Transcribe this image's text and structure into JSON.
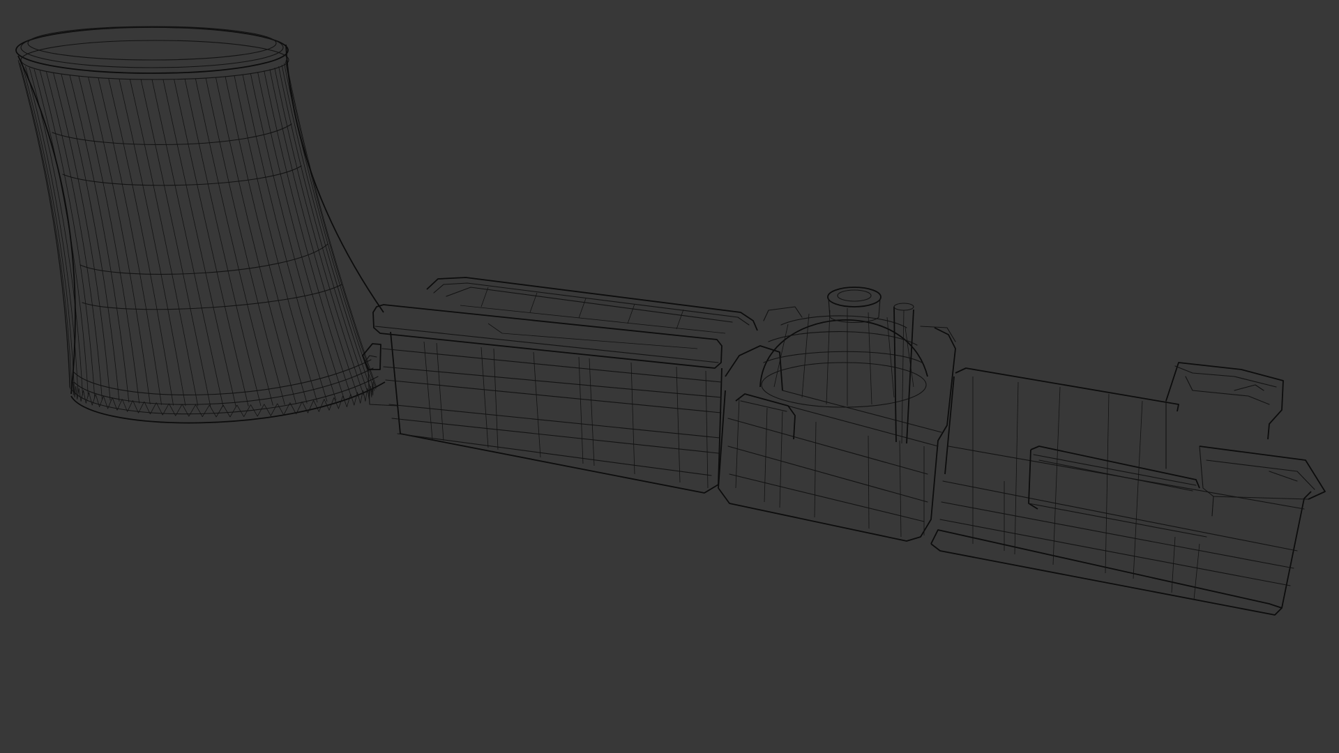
{
  "viewport": {
    "background_color": "#383838",
    "wire_color": "#121212",
    "shading_mode": "wireframe"
  },
  "scene": {
    "objects": [
      {
        "name": "cooling-tower"
      },
      {
        "name": "turbine-hall"
      },
      {
        "name": "reactor-building"
      },
      {
        "name": "auxiliary-building"
      }
    ]
  }
}
